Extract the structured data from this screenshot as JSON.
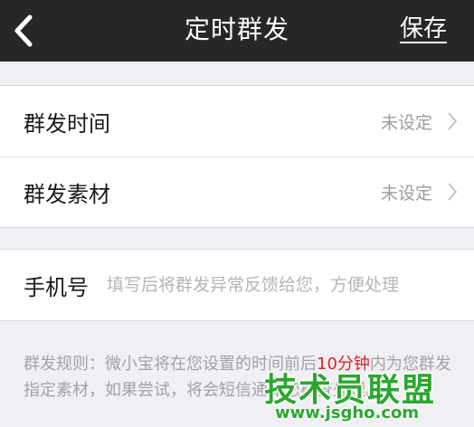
{
  "navbar": {
    "title": "定时群发",
    "save_label": "保存",
    "back_icon": "chevron-left-icon"
  },
  "settings": {
    "items": [
      {
        "label": "群发时间",
        "value": "未设定"
      },
      {
        "label": "群发素材",
        "value": "未设定"
      }
    ]
  },
  "phone": {
    "label": "手机号",
    "placeholder": "填写后将群发异常反馈给您，方便处理",
    "value": ""
  },
  "rules": {
    "part1": "群发规则：微小宝将在您设置的时间前后",
    "highlight": "10分钟",
    "part2": "内为您群发指定素材，如果尝试",
    "part3": "，将会短信通知您检查处理。"
  },
  "watermark": {
    "title": "技术员联盟",
    "url": "www.jsgho.com"
  },
  "colors": {
    "navbar_bg": "#262729",
    "page_bg": "#efeff4",
    "highlight": "#e02020",
    "watermark": "#2aa82e"
  }
}
